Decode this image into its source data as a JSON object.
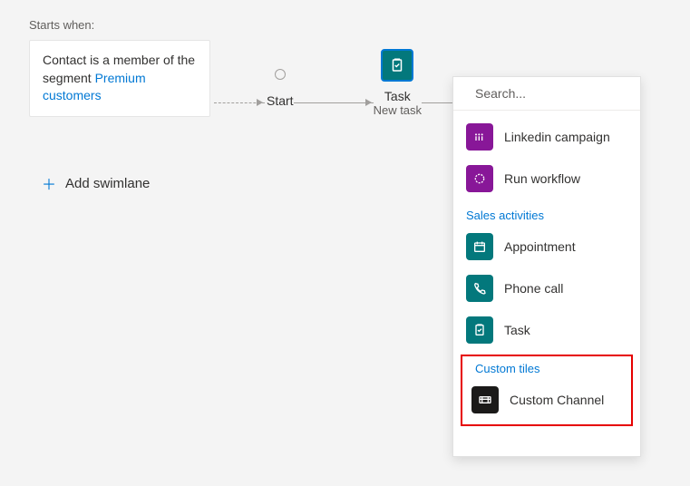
{
  "header": {
    "starts_when_label": "Starts when:"
  },
  "trigger": {
    "text_prefix": "Contact is a member of the segment ",
    "link_text": "Premium customers"
  },
  "flow": {
    "start_label": "Start",
    "task_label": "Task",
    "task_sub": "New task"
  },
  "actions": {
    "add_swimlane": "Add swimlane"
  },
  "panel": {
    "search_placeholder": "Search...",
    "items_top": [
      {
        "label": "Linkedin campaign",
        "icon": "linkedin-icon",
        "bg": "bg-purple"
      },
      {
        "label": "Run workflow",
        "icon": "workflow-icon",
        "bg": "bg-purple"
      }
    ],
    "sections": [
      {
        "title": "Sales activities",
        "items": [
          {
            "label": "Appointment",
            "icon": "calendar-icon",
            "bg": "bg-teal"
          },
          {
            "label": "Phone call",
            "icon": "phone-icon",
            "bg": "bg-teal"
          },
          {
            "label": "Task",
            "icon": "clipboard-icon",
            "bg": "bg-teal"
          }
        ]
      }
    ],
    "highlighted": {
      "title": "Custom tiles",
      "items": [
        {
          "label": "Custom Channel",
          "icon": "channel-icon",
          "bg": "bg-black"
        }
      ]
    }
  }
}
